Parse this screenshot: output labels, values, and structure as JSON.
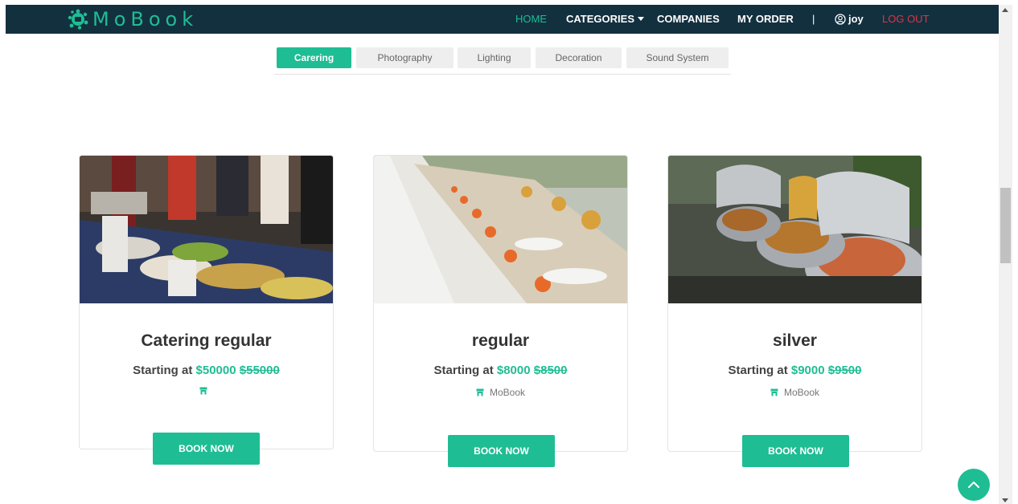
{
  "brand": {
    "name": "MoBook",
    "accent": "#1fbd94",
    "nav_bg": "#13303f"
  },
  "nav": {
    "home": "HOME",
    "categories": "CATEGORIES",
    "companies": "COMPANIES",
    "my_order": "MY ORDER",
    "separator": "|",
    "user": "joy",
    "logout": "LOG OUT"
  },
  "tabs": [
    {
      "label": "Carering",
      "active": true
    },
    {
      "label": "Photography",
      "active": false
    },
    {
      "label": "Lighting",
      "active": false
    },
    {
      "label": "Decoration",
      "active": false
    },
    {
      "label": "Sound System",
      "active": false
    }
  ],
  "cards": [
    {
      "title": "Catering regular",
      "price_prefix": "Starting at",
      "price": "$50000",
      "old_price": "$55000",
      "company": "",
      "button": "BOOK NOW"
    },
    {
      "title": "regular",
      "price_prefix": "Starting at",
      "price": "$8000",
      "old_price": "$8500",
      "company": "MoBook",
      "button": "BOOK NOW"
    },
    {
      "title": "silver",
      "price_prefix": "Starting at",
      "price": "$9000",
      "old_price": "$9500",
      "company": "MoBook",
      "button": "BOOK NOW"
    }
  ],
  "icons": {
    "logo": "splash-logo-icon",
    "user": "user-circle-icon",
    "shop": "shop-icon",
    "back_to_top": "chevron-up-icon",
    "dropdown": "caret-down-icon"
  }
}
